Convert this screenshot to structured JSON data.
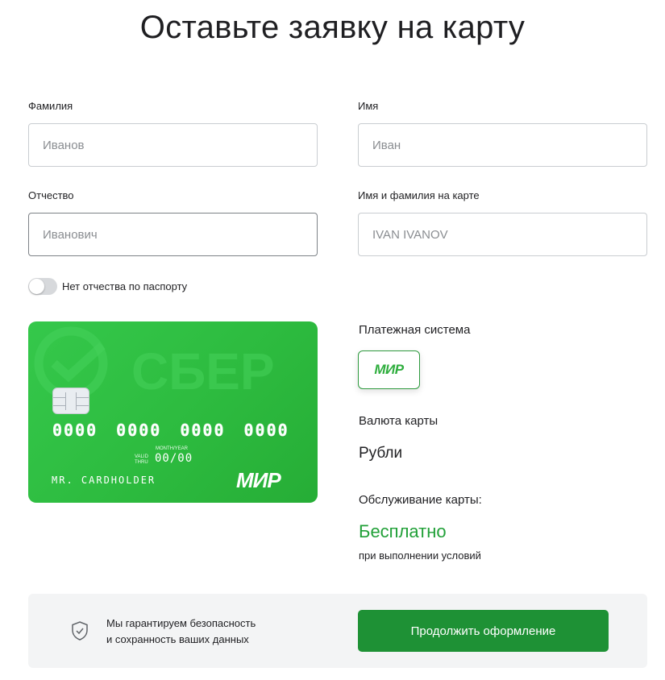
{
  "page": {
    "title": "Оставьте заявку на карту"
  },
  "form": {
    "last_name": {
      "label": "Фамилия",
      "placeholder": "Иванов",
      "value": ""
    },
    "first_name": {
      "label": "Имя",
      "placeholder": "Иван",
      "value": ""
    },
    "middle_name": {
      "label": "Отчество",
      "placeholder": "Иванович",
      "value": ""
    },
    "card_name": {
      "label": "Имя и фамилия на карте",
      "placeholder": "IVAN IVANOV",
      "value": ""
    },
    "no_patronymic": {
      "label": "Нет отчества по паспорту",
      "checked": false
    }
  },
  "card_preview": {
    "brand_watermark": "СБЕР",
    "number_groups": [
      "0000",
      "0000",
      "0000",
      "0000"
    ],
    "valid_thru_label": "VALID THRU",
    "month_year_label": "MONTH/YEAR",
    "expiry": "00/00",
    "holder": "MR. CARDHOLDER",
    "network_logo": "МИР",
    "background_color": "#2dbb3f"
  },
  "details": {
    "payment_system_label": "Платежная система",
    "payment_system_logo": "МИР",
    "currency_label": "Валюта карты",
    "currency_value": "Рубли",
    "service_label": "Обслуживание карты:",
    "service_value": "Бесплатно",
    "service_note": "при выполнении условий"
  },
  "footer": {
    "guarantee_line1": "Мы гарантируем безопасность",
    "guarantee_line2": "и сохранность ваших данных",
    "continue_label": "Продолжить оформление",
    "shield_icon": "shield-check-icon"
  },
  "colors": {
    "accent": "#21a038",
    "button": "#1e9135",
    "footer_bg": "#f3f4f5"
  }
}
